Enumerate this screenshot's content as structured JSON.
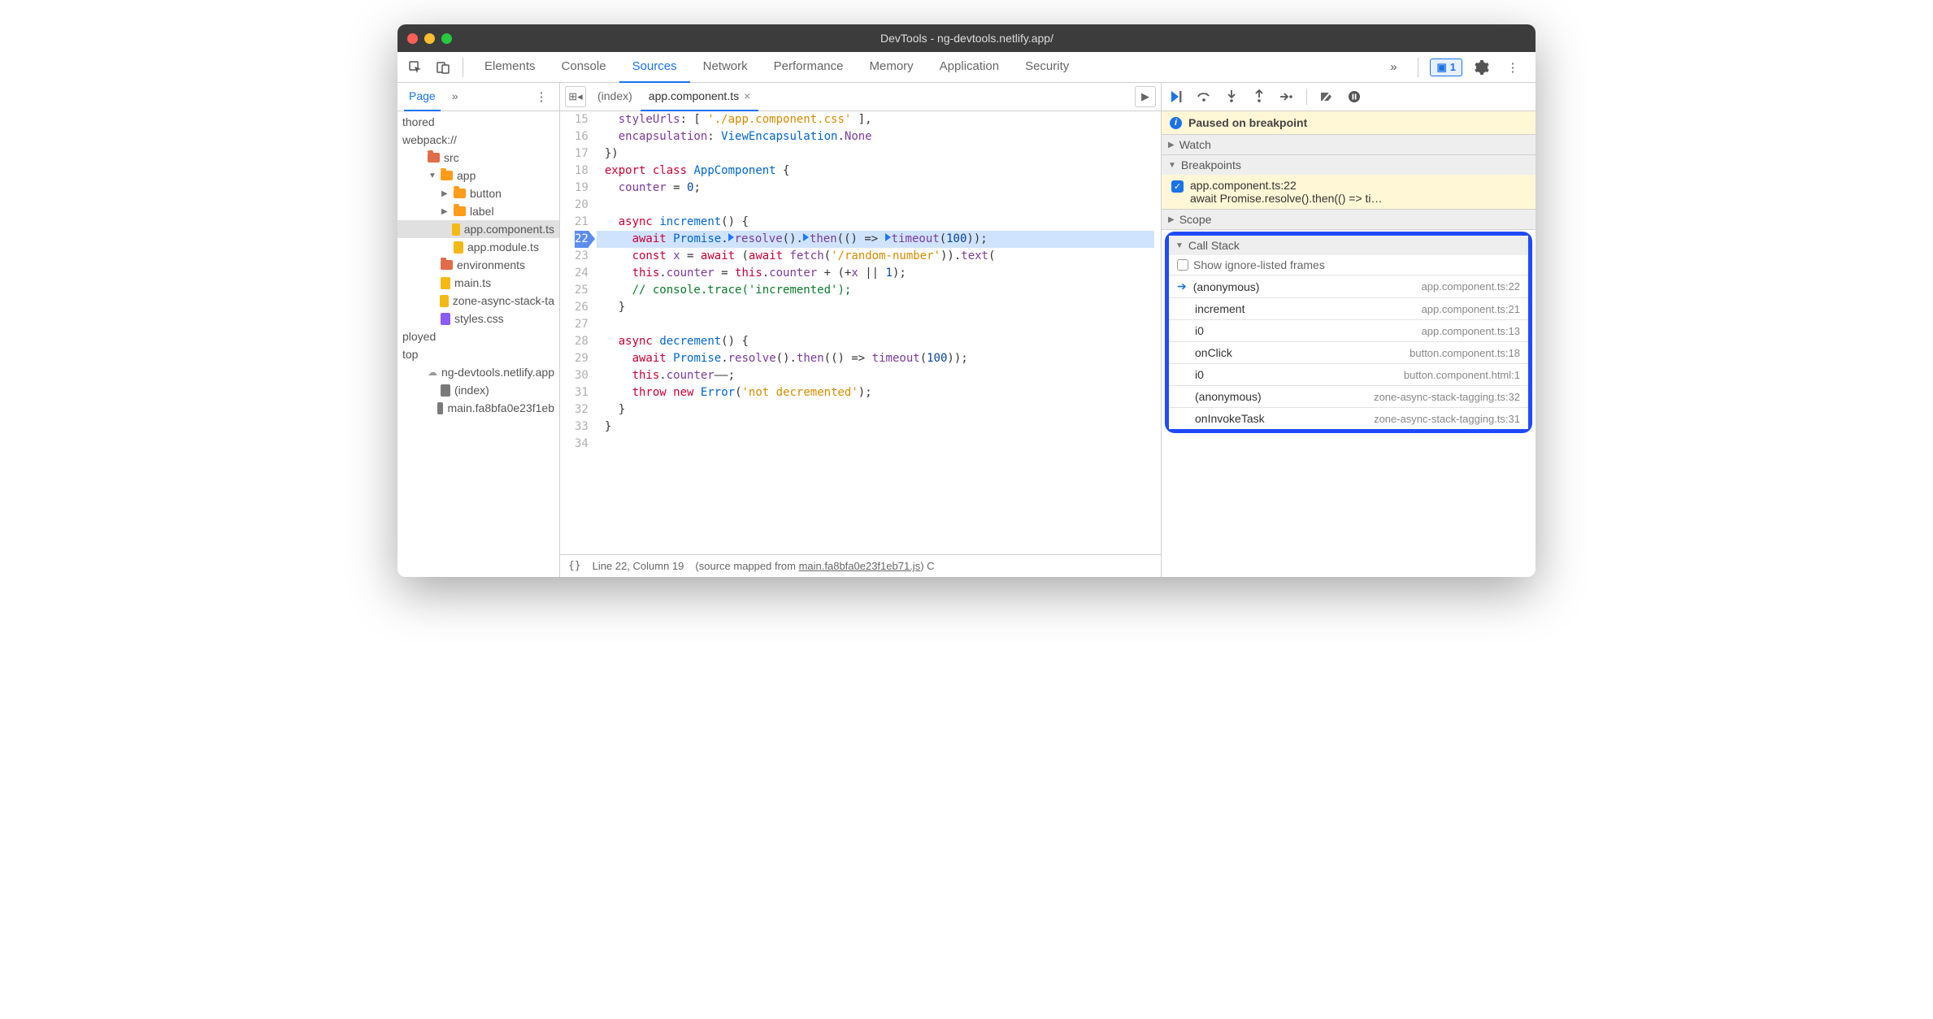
{
  "window": {
    "title": "DevTools - ng-devtools.netlify.app/"
  },
  "toolbar": {
    "tabs": [
      "Elements",
      "Console",
      "Sources",
      "Network",
      "Performance",
      "Memory",
      "Application",
      "Security"
    ],
    "active_index": 2,
    "overflow_glyph": "»",
    "badge": {
      "glyph": "▣",
      "count": "1"
    }
  },
  "navigator": {
    "tabs": [
      "Page"
    ],
    "overflow_glyph": "»",
    "tree": [
      {
        "label": "thored",
        "depth": 0,
        "type": "text"
      },
      {
        "label": "webpack://",
        "depth": 0,
        "type": "text"
      },
      {
        "label": "src",
        "depth": 1,
        "type": "folder-red"
      },
      {
        "label": "app",
        "depth": 2,
        "type": "folder",
        "arrow": "▼"
      },
      {
        "label": "button",
        "depth": 3,
        "type": "folder",
        "arrow": "▶"
      },
      {
        "label": "label",
        "depth": 3,
        "type": "folder",
        "arrow": "▶"
      },
      {
        "label": "app.component.ts",
        "depth": 3,
        "type": "file",
        "selected": true
      },
      {
        "label": "app.module.ts",
        "depth": 3,
        "type": "file"
      },
      {
        "label": "environments",
        "depth": 2,
        "type": "folder-red"
      },
      {
        "label": "main.ts",
        "depth": 2,
        "type": "file"
      },
      {
        "label": "zone-async-stack-ta",
        "depth": 2,
        "type": "file"
      },
      {
        "label": "styles.css",
        "depth": 2,
        "type": "file-purple"
      },
      {
        "label": "ployed",
        "depth": 0,
        "type": "text"
      },
      {
        "label": "top",
        "depth": 0,
        "type": "text"
      },
      {
        "label": "ng-devtools.netlify.app",
        "depth": 1,
        "type": "cloud"
      },
      {
        "label": "(index)",
        "depth": 2,
        "type": "file-dark"
      },
      {
        "label": "main.fa8bfa0e23f1eb",
        "depth": 2,
        "type": "file-dark"
      }
    ]
  },
  "editor": {
    "tabs": [
      {
        "label": "(index)",
        "active": false
      },
      {
        "label": "app.component.ts",
        "active": true,
        "closable": true
      }
    ],
    "run_glyph": "▶",
    "first_line": 15,
    "bp_line": 22,
    "status": {
      "braces": "{}",
      "pos": "Line 22, Column 19",
      "mapped_prefix": "(source mapped from ",
      "mapped_link": "main.fa8bfa0e23f1eb71.js",
      "mapped_suffix": ") C"
    }
  },
  "debug": {
    "banner": "Paused on breakpoint",
    "watch": {
      "label": "Watch"
    },
    "breakpoints": {
      "label": "Breakpoints",
      "items": [
        {
          "name": "app.component.ts:22",
          "preview": "await Promise.resolve().then(() => ti…"
        }
      ]
    },
    "scope": {
      "label": "Scope"
    },
    "callstack": {
      "label": "Call Stack",
      "show_label": "Show ignore-listed frames",
      "frames": [
        {
          "fn": "(anonymous)",
          "loc": "app.component.ts:22",
          "current": true
        },
        {
          "fn": "increment",
          "loc": "app.component.ts:21"
        },
        {
          "fn": "i0",
          "loc": "app.component.ts:13"
        },
        {
          "fn": "onClick",
          "loc": "button.component.ts:18"
        },
        {
          "fn": "i0",
          "loc": "button.component.html:1"
        },
        {
          "fn": "(anonymous)",
          "loc": "zone-async-stack-tagging.ts:32"
        },
        {
          "fn": "onInvokeTask",
          "loc": "zone-async-stack-tagging.ts:31"
        }
      ]
    }
  }
}
